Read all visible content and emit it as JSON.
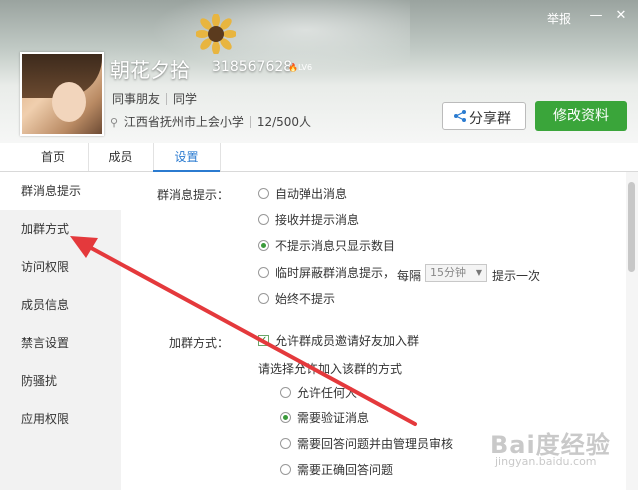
{
  "header": {
    "report": "举报",
    "group_name": "朝花夕拾",
    "group_id": "318567628",
    "level_badge": "LV6",
    "tags": [
      "同事朋友",
      "同学"
    ],
    "location": "江西省抚州市上会小学",
    "members": "12/500人",
    "share_label": "分享群",
    "edit_label": "修改资料"
  },
  "tabs": [
    "首页",
    "成员",
    "设置"
  ],
  "sidebar": [
    "群消息提示",
    "加群方式",
    "访问权限",
    "成员信息",
    "禁言设置",
    "防骚扰",
    "应用权限"
  ],
  "msg_settings": {
    "label": "群消息提示：",
    "options": [
      "自动弹出消息",
      "接收并提示消息",
      "不提示消息只显示数目",
      "临时屏蔽群消息提示，",
      "始终不提示"
    ],
    "selected_index": 2,
    "interval_prefix": "每隔",
    "interval_value": "15分钟",
    "interval_suffix": "提示一次"
  },
  "join_settings": {
    "label": "加群方式：",
    "allow_invite": "允许群成员邀请好友加入群",
    "choose_label": "请选择允许加入该群的方式",
    "options": [
      "允许任何人",
      "需要验证消息",
      "需要回答问题并由管理员审核",
      "需要正确回答问题"
    ],
    "selected_index": 1
  },
  "watermark": {
    "brand": "Bai度经验",
    "url": "jingyan.baidu.com"
  }
}
